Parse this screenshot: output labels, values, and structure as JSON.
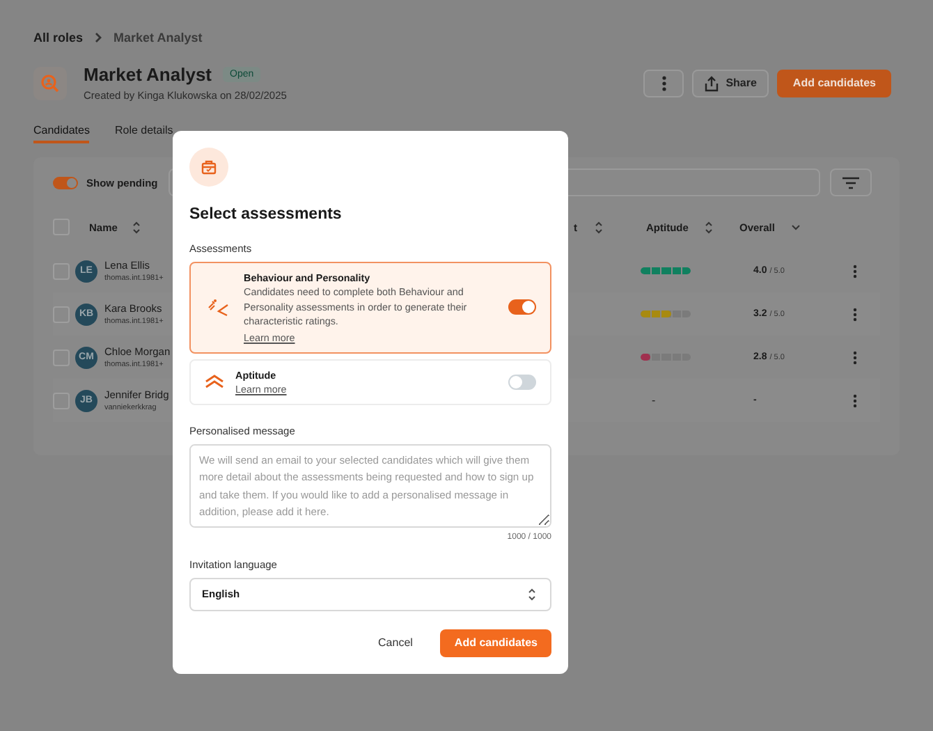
{
  "breadcrumb": [
    {
      "label": "All roles"
    },
    {
      "label": "Market Analyst"
    }
  ],
  "role": {
    "title": "Market Analyst",
    "status": "Open",
    "created": "Created by Kinga Klukowska on 28/02/2025"
  },
  "actions": {
    "share": "Share",
    "add": "Add candidates"
  },
  "tabs": [
    {
      "label": "Candidates",
      "selected": true
    },
    {
      "label": "Role details",
      "selected": false
    }
  ],
  "show_pending": {
    "label": "Show pending",
    "on": true
  },
  "table": {
    "select_all": {
      "checked": false
    },
    "columns": [
      {
        "label": "Name"
      },
      {
        "label": "t"
      },
      {
        "label": "Aptitude"
      },
      {
        "label": "Overall"
      }
    ],
    "rows": [
      {
        "checked": false,
        "initials": "LE",
        "name": "Lena Ellis",
        "email": "thomas.int.1981+",
        "aptitude": {
          "level": 1,
          "color": "#10805f"
        },
        "score": "4.0",
        "out_of": "/ 5.0"
      },
      {
        "checked": false,
        "initials": "KB",
        "name": "Kara Brooks",
        "email": "thomas.int.1981+",
        "aptitude": {
          "level": 0.6,
          "color": "#a88a10"
        },
        "score": "3.2",
        "out_of": "/ 5.0"
      },
      {
        "checked": false,
        "initials": "CM",
        "name": "Chloe Morgan",
        "email": "thomas.int.1981+",
        "aptitude": {
          "level": 0.2,
          "color": "#a0304f"
        },
        "score": "2.8",
        "out_of": "/ 5.0"
      },
      {
        "checked": false,
        "initials": "JB",
        "name": "Jennifer Bridg",
        "email": "vanniekerkkrag",
        "aptitude_text": "-",
        "score": "-"
      }
    ]
  },
  "modal": {
    "title": "Select assessments",
    "assessments_label": "Assessments",
    "assessments": [
      {
        "kind": "behaviour",
        "title": "Behaviour and Personality",
        "description": "Candidates need to complete both Behaviour and Personality assessments in order to generate their characteristic ratings.",
        "link": "Learn more",
        "on": true
      },
      {
        "kind": "aptitude",
        "title": "Aptitude",
        "link": "Learn more",
        "on": false
      }
    ],
    "message_label": "Personalised message",
    "message_placeholder": "We will send an email to your selected candidates which will give them more detail about the assessments being requested and how to sign up and take them. If you would like to add a personalised message in addition, please add it here.",
    "counter": "1000 / 1000",
    "language_label": "Invitation language",
    "language": "English",
    "cancel": "Cancel",
    "submit": "Add candidates"
  }
}
